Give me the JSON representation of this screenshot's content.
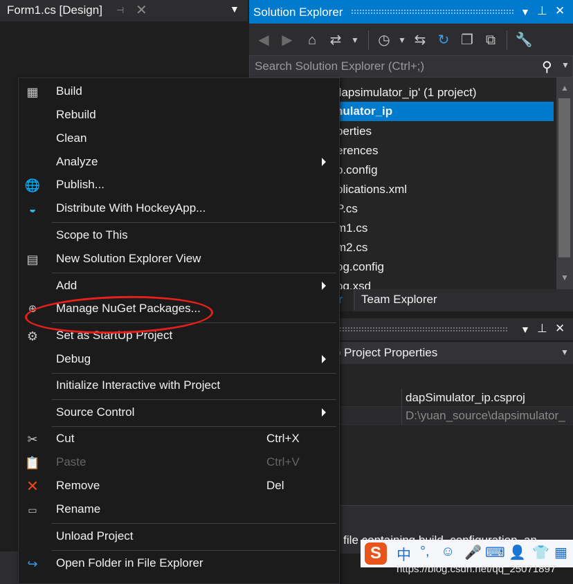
{
  "design_tab": {
    "title": "Form1.cs [Design]"
  },
  "solution_explorer": {
    "title": "Solution Explorer",
    "search_placeholder": "Search Solution Explorer (Ctrl+;)",
    "tree": [
      {
        "text": "dapsimulator_ip' (1 project)",
        "selected": false
      },
      {
        "text": "nulator_ip",
        "selected": true
      },
      {
        "text": "perties",
        "selected": false
      },
      {
        "text": "erences",
        "selected": false
      },
      {
        "text": "p.config",
        "selected": false
      },
      {
        "text": "plications.xml",
        "selected": false
      },
      {
        "text": "P.cs",
        "selected": false
      },
      {
        "text": "m1.cs",
        "selected": false
      },
      {
        "text": "m2.cs",
        "selected": false
      },
      {
        "text": "og.config",
        "selected": false
      },
      {
        "text": "og.xsd",
        "selected": false
      }
    ],
    "tabs": {
      "active": "er",
      "other": "Team Explorer"
    }
  },
  "properties": {
    "object_title_bold": "p",
    "object_title": "Project Properties",
    "rows": [
      {
        "value": "dapSimulator_ip.csproj",
        "color": "#f1f1f1"
      },
      {
        "value": "D:\\yuan_source\\dapsimulator_",
        "color": "#8a8a8a"
      }
    ],
    "description": "e file containing build, configuration, an"
  },
  "context_menu": {
    "items": [
      {
        "id": "build",
        "label": "Build",
        "icon": "build-icon"
      },
      {
        "id": "rebuild",
        "label": "Rebuild"
      },
      {
        "id": "clean",
        "label": "Clean"
      },
      {
        "id": "analyze",
        "label": "Analyze",
        "submenu": true
      },
      {
        "id": "publish",
        "label": "Publish...",
        "icon": "globe-icon"
      },
      {
        "id": "distribute",
        "label": "Distribute With HockeyApp...",
        "icon": "hockeyapp-icon"
      },
      {
        "id": "scope",
        "label": "Scope to This"
      },
      {
        "id": "new-se-view",
        "label": "New Solution Explorer View",
        "icon": "new-view-icon"
      },
      {
        "id": "add",
        "label": "Add",
        "submenu": true
      },
      {
        "id": "nuget",
        "label": "Manage NuGet Packages...",
        "icon": "nuget-icon"
      },
      {
        "id": "startup",
        "label": "Set as StartUp Project",
        "icon": "gear-icon"
      },
      {
        "id": "debug",
        "label": "Debug",
        "submenu": true
      },
      {
        "id": "interactive",
        "label": "Initialize Interactive with Project"
      },
      {
        "id": "source-control",
        "label": "Source Control",
        "submenu": true
      },
      {
        "id": "cut",
        "label": "Cut",
        "shortcut": "Ctrl+X",
        "icon": "scissors-icon"
      },
      {
        "id": "paste",
        "label": "Paste",
        "shortcut": "Ctrl+V",
        "icon": "clipboard-icon",
        "disabled": true
      },
      {
        "id": "remove",
        "label": "Remove",
        "shortcut": "Del",
        "icon": "remove-icon"
      },
      {
        "id": "rename",
        "label": "Rename",
        "icon": "rename-icon"
      },
      {
        "id": "unload",
        "label": "Unload Project"
      },
      {
        "id": "open-folder",
        "label": "Open Folder in File Explorer",
        "icon": "refresh-arrow-icon"
      }
    ]
  },
  "ime_bar": {
    "logo": "S",
    "lang": "中",
    "punct": "°,"
  },
  "watermark": "https://blog.csdn.net/qq_25071897",
  "colors": {
    "accent": "#007acc",
    "menu_bg": "#1b1b1c",
    "annotation": "#e8201c"
  }
}
